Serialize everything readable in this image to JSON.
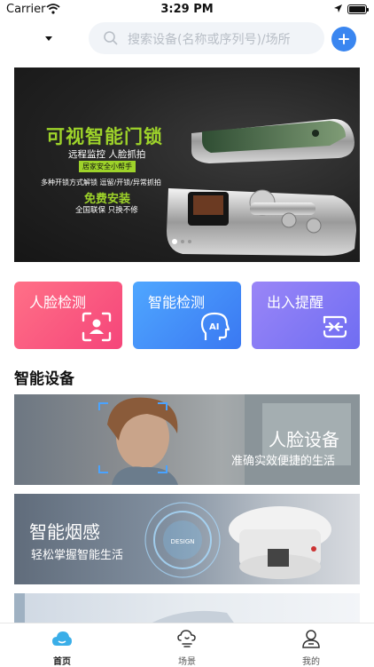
{
  "status_bar": {
    "carrier": "Carrier",
    "time": "3:29 PM"
  },
  "header": {
    "search_placeholder": "搜索设备(名称或序列号)/场所"
  },
  "banner": {
    "title": "可视智能门锁",
    "subtitle": "远程监控 人脸抓拍",
    "tag": "居家安全小帮手",
    "features": "多种开锁方式解锁 逗留/开锁/异常抓拍",
    "promo": "免费安装",
    "guarantee": "全国联保 只换不修",
    "page_count": 3,
    "active_page": 1
  },
  "quick_actions": [
    {
      "label": "人脸检测",
      "icon": "face-scan-icon",
      "color": "#f5457a"
    },
    {
      "label": "智能检测",
      "icon": "ai-head-icon",
      "color": "#3a78f2"
    },
    {
      "label": "出入提醒",
      "icon": "entry-exit-icon",
      "color": "#6f6df2"
    }
  ],
  "section": {
    "title": "智能设备"
  },
  "devices": [
    {
      "title": "人脸设备",
      "subtitle": "准确实效便捷的生活"
    },
    {
      "title": "智能烟感",
      "subtitle": "轻松掌握智能生活",
      "badge": "DESIGN"
    },
    {
      "title": "",
      "subtitle": ""
    }
  ],
  "tabs": [
    {
      "label": "首页",
      "icon": "cloud-home-icon",
      "active": true
    },
    {
      "label": "场景",
      "icon": "scene-icon",
      "active": false
    },
    {
      "label": "我的",
      "icon": "profile-icon",
      "active": false
    }
  ]
}
